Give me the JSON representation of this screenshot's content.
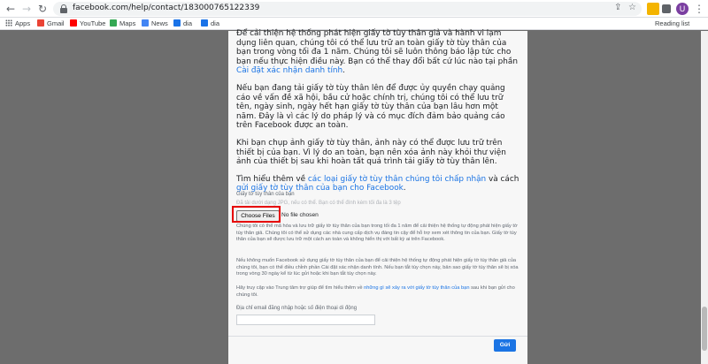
{
  "browser": {
    "url": "facebook.com/help/contact/183000765122339",
    "avatar_letter": "U",
    "reading_list": "Reading list"
  },
  "bookmarks": [
    {
      "label": "Apps",
      "icon": "apps-icon"
    },
    {
      "label": "Gmail",
      "icon": "gmail-icon",
      "color": "#ea4335"
    },
    {
      "label": "YouTube",
      "icon": "youtube-icon",
      "color": "#ff0000"
    },
    {
      "label": "Maps",
      "icon": "maps-icon",
      "color": "#34a853"
    },
    {
      "label": "News",
      "icon": "news-icon",
      "color": "#4285f4"
    },
    {
      "label": "dia",
      "icon": "bookmark-icon",
      "color": "#1a73e8"
    },
    {
      "label": "dia",
      "icon": "bookmark-icon",
      "color": "#1a73e8"
    }
  ],
  "info": {
    "p1": "Để cải thiện hệ thống phát hiện giấy tờ tùy thân giả và hành vi lạm dụng liên quan, chúng tôi có thể lưu trữ an toàn giấy tờ tùy thân của bạn trong vòng tối đa 1 năm. Chúng tôi sẽ luôn thông báo lập tức cho bạn nếu thực hiện điều này. Bạn có thể thay đổi bất cứ lúc nào tại phần ",
    "p1_link": "Cài đặt xác nhận danh tính",
    "p1_end": ".",
    "p2": "Nếu bạn đang tải giấy tờ tùy thân lên để được ủy quyền chạy quảng cáo về vấn đề xã hội, bầu cử hoặc chính trị, chúng tôi có thể lưu trữ tên, ngày sinh, ngày hết hạn giấy tờ tùy thân của bạn lâu hơn một năm. Đây là vì các lý do pháp lý và có mục đích đảm bảo quảng cáo trên Facebook được an toàn.",
    "p3": "Khi bạn chụp ảnh giấy tờ tùy thân, ảnh này có thể được lưu trữ trên thiết bị của bạn. Vì lý do an toàn, bạn nên xóa ảnh này khỏi thư viện ảnh của thiết bị sau khi hoàn tất quá trình tải giấy tờ tùy thân lên.",
    "p4_start": "Tìm hiểu thêm về ",
    "p4_link1": "các loại giấy tờ tùy thân chúng tôi chấp nhận",
    "p4_mid": " và cách ",
    "p4_link2": "gửi giấy tờ tùy thân của bạn cho Facebook",
    "p4_end": "."
  },
  "form": {
    "id_label": "Giấy tờ tùy thân của bạn",
    "id_hint": "Đã tải dưới dạng JPG, nếu có thể. Bạn có thể đính kèm tối đa là 3 tệp",
    "choose_files": "Choose Files",
    "no_file": "No file chosen",
    "note1": "Chúng tôi có thể mã hóa và lưu trữ giấy tờ tùy thân của bạn trong tối đa 1 năm để cải thiện hệ thống tự động phát hiện giấy tờ tùy thân giả. Chúng tôi có thể sử dụng các nhà cung cấp dịch vụ đáng tin cậy để hỗ trợ xem xét thông tin của bạn. Giấy tờ tùy thân của bạn sẽ được lưu trữ một cách an toàn và không hiển thị với bất kỳ ai trên Facebook.",
    "note2": "Nếu không muốn Facebook sử dụng giấy tờ tùy thân của bạn để cải thiện hệ thống tự động phát hiện giấy tờ tùy thân giả của chúng tôi, bạn có thể điều chỉnh phần Cài đặt xác nhận danh tính. Nếu bạn tắt tùy chọn này, bản sao giấy tờ tùy thân sẽ bị xóa trong vòng 30 ngày kể từ lúc gửi hoặc khi bạn tắt tùy chọn này.",
    "note3_start": "Hãy truy cập vào Trung tâm trợ giúp để tìm hiểu thêm về ",
    "note3_link": "những gì sẽ xảy ra với giấy tờ tùy thân của bạn",
    "note3_end": " sau khi bạn gửi cho chúng tôi.",
    "email_label": "Địa chỉ email đăng nhập hoặc số điện thoại di động",
    "email_value": "",
    "submit": "Gửi"
  },
  "colors": {
    "accent": "#1b74e4",
    "highlight": "#e60000"
  }
}
